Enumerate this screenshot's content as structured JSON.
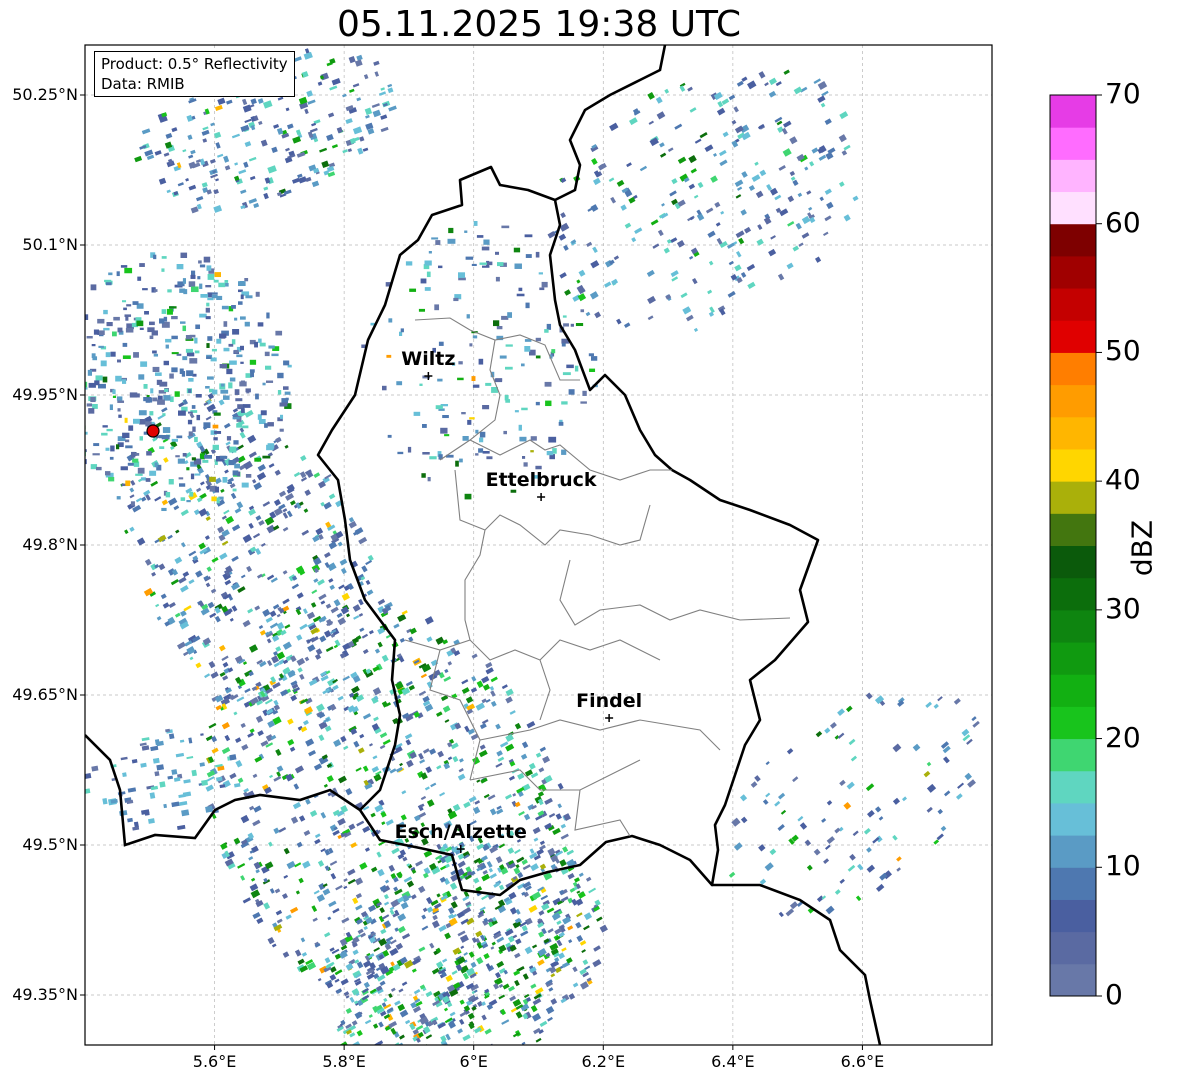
{
  "title": "05.11.2025 19:38 UTC",
  "info": {
    "product": "Product: 0.5° Reflectivity",
    "data": "Data: RMIB"
  },
  "map": {
    "lon_range": [
      5.4,
      6.8
    ],
    "lat_range": [
      49.3,
      50.3
    ],
    "lat_ticks": [
      {
        "value": 50.25,
        "label": "50.25°N"
      },
      {
        "value": 50.1,
        "label": "50.1°N"
      },
      {
        "value": 49.95,
        "label": "49.95°N"
      },
      {
        "value": 49.8,
        "label": "49.8°N"
      },
      {
        "value": 49.65,
        "label": "49.65°N"
      },
      {
        "value": 49.5,
        "label": "49.5°N"
      },
      {
        "value": 49.35,
        "label": "49.35°N"
      }
    ],
    "lon_ticks": [
      {
        "value": 5.6,
        "label": "5.6°E"
      },
      {
        "value": 5.8,
        "label": "5.8°E"
      },
      {
        "value": 6.0,
        "label": "6°E"
      },
      {
        "value": 6.2,
        "label": "6.2°E"
      },
      {
        "value": 6.4,
        "label": "6.4°E"
      },
      {
        "value": 6.6,
        "label": "6.6°E"
      }
    ],
    "cities": [
      {
        "name": "Wiltz",
        "lon": 5.93,
        "lat": 49.969
      },
      {
        "name": "Ettelbruck",
        "lon": 6.104,
        "lat": 49.848
      },
      {
        "name": "Findel",
        "lon": 6.209,
        "lat": 49.627
      },
      {
        "name": "Esch/Alzette",
        "lon": 5.98,
        "lat": 49.496
      }
    ],
    "radar_site": {
      "lon": 5.505,
      "lat": 49.914,
      "color": "#e00000"
    },
    "grid": true
  },
  "colorbar": {
    "label": "dBZ",
    "min": 0,
    "max": 70,
    "tick_labels": [
      "0",
      "10",
      "20",
      "30",
      "40",
      "50",
      "60",
      "70"
    ],
    "colors": [
      "#6878a8",
      "#5a6aa2",
      "#4a5fa0",
      "#4e78b0",
      "#5a9bc5",
      "#67bfd8",
      "#5fd6c0",
      "#3fd671",
      "#18c41c",
      "#12b012",
      "#109a10",
      "#0e8510",
      "#0c6e0c",
      "#0b5a0b",
      "#43760f",
      "#aab00a",
      "#ffd600",
      "#ffb600",
      "#ff9c00",
      "#ff7e00",
      "#e00000",
      "#c40000",
      "#a00000",
      "#7e0000",
      "#ffe0ff",
      "#ffb4ff",
      "#ff6cff",
      "#e63ce6"
    ]
  }
}
